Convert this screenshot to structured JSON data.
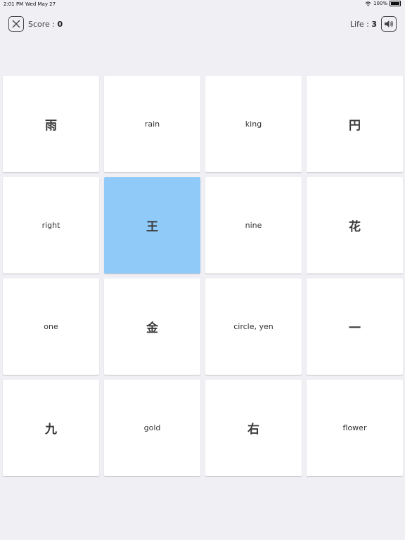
{
  "status": {
    "time": "2:01 PM",
    "date": "Wed May 27",
    "battery": "100%"
  },
  "header": {
    "score_label": "Score : ",
    "score_value": "0",
    "life_label": "Life : ",
    "life_value": "3"
  },
  "icons": {
    "close": "close-icon",
    "sound": "speaker-icon"
  },
  "colors": {
    "selected": "#90caf9",
    "background": "#efeff4"
  },
  "cards": [
    {
      "text": "雨",
      "kanji": true,
      "selected": false
    },
    {
      "text": "rain",
      "kanji": false,
      "selected": false
    },
    {
      "text": "king",
      "kanji": false,
      "selected": false
    },
    {
      "text": "円",
      "kanji": true,
      "selected": false
    },
    {
      "text": "right",
      "kanji": false,
      "selected": false
    },
    {
      "text": "王",
      "kanji": true,
      "selected": true
    },
    {
      "text": "nine",
      "kanji": false,
      "selected": false
    },
    {
      "text": "花",
      "kanji": true,
      "selected": false
    },
    {
      "text": "one",
      "kanji": false,
      "selected": false
    },
    {
      "text": "金",
      "kanji": true,
      "selected": false
    },
    {
      "text": "circle, yen",
      "kanji": false,
      "selected": false
    },
    {
      "text": "一",
      "kanji": true,
      "selected": false
    },
    {
      "text": "九",
      "kanji": true,
      "selected": false
    },
    {
      "text": "gold",
      "kanji": false,
      "selected": false
    },
    {
      "text": "右",
      "kanji": true,
      "selected": false
    },
    {
      "text": "flower",
      "kanji": false,
      "selected": false
    }
  ]
}
